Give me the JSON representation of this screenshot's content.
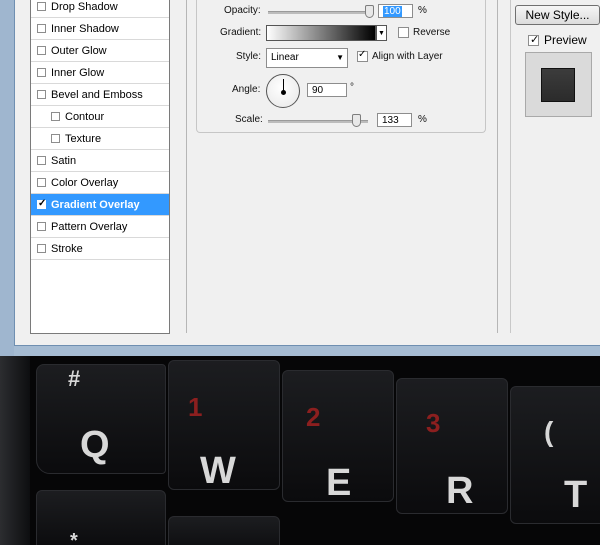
{
  "layer_styles": {
    "items": [
      {
        "label": "Drop Shadow",
        "checked": false,
        "selected": false,
        "sub": false
      },
      {
        "label": "Inner Shadow",
        "checked": false,
        "selected": false,
        "sub": false
      },
      {
        "label": "Outer Glow",
        "checked": false,
        "selected": false,
        "sub": false
      },
      {
        "label": "Inner Glow",
        "checked": false,
        "selected": false,
        "sub": false
      },
      {
        "label": "Bevel and Emboss",
        "checked": false,
        "selected": false,
        "sub": false
      },
      {
        "label": "Contour",
        "checked": false,
        "selected": false,
        "sub": true
      },
      {
        "label": "Texture",
        "checked": false,
        "selected": false,
        "sub": true
      },
      {
        "label": "Satin",
        "checked": false,
        "selected": false,
        "sub": false
      },
      {
        "label": "Color Overlay",
        "checked": false,
        "selected": false,
        "sub": false
      },
      {
        "label": "Gradient Overlay",
        "checked": true,
        "selected": true,
        "sub": false
      },
      {
        "label": "Pattern Overlay",
        "checked": false,
        "selected": false,
        "sub": false
      },
      {
        "label": "Stroke",
        "checked": false,
        "selected": false,
        "sub": false
      }
    ]
  },
  "gradient_overlay": {
    "opacity_label": "Opacity:",
    "opacity_value": "100",
    "opacity_unit": "%",
    "gradient_label": "Gradient:",
    "reverse_label": "Reverse",
    "reverse_checked": false,
    "style_label": "Style:",
    "style_value": "Linear",
    "align_label": "Align with Layer",
    "align_checked": true,
    "angle_label": "Angle:",
    "angle_value": "90",
    "angle_unit": "°",
    "scale_label": "Scale:",
    "scale_value": "133",
    "scale_unit": "%",
    "gradient_colors": [
      "#ffffff",
      "#000000"
    ]
  },
  "right_panel": {
    "new_style_label": "New Style...",
    "preview_label": "Preview",
    "preview_checked": true
  },
  "keyboard": {
    "keys": [
      {
        "letter": "Q",
        "symbol": "#",
        "number": ""
      },
      {
        "letter": "W",
        "symbol": "",
        "number": "1"
      },
      {
        "letter": "E",
        "symbol": "",
        "number": "2"
      },
      {
        "letter": "R",
        "symbol": "",
        "number": "3"
      },
      {
        "letter": "T",
        "symbol": "(",
        "number": ""
      }
    ],
    "bottom_symbol": "*"
  },
  "colors": {
    "selection": "#3399ff",
    "key_number": "#8c1f1f",
    "key_letter": "#d8d8d8"
  }
}
